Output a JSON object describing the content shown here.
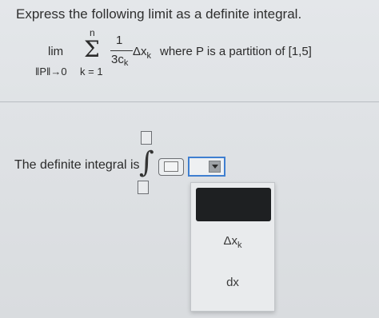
{
  "question": {
    "prompt": "Express the following limit as a definite integral."
  },
  "limit_expression": {
    "lim": "lim",
    "lim_sub": "‖P‖→0",
    "sum_upper": "n",
    "sum_symbol": "Σ",
    "sum_lower": "k = 1",
    "frac_numerator": "1",
    "frac_denominator": "3c",
    "frac_denominator_sub": "k",
    "delta": "Δx",
    "delta_sub": "k",
    "where_text": "where P is a partition of [1,5]"
  },
  "answer": {
    "label": "The definite integral is",
    "integral_symbol": "∫"
  },
  "dropdown": {
    "options": [
      {
        "main": "",
        "sub": ""
      },
      {
        "main": "Δx",
        "sub": "k"
      },
      {
        "main": "dx",
        "sub": ""
      }
    ]
  },
  "colors": {
    "accent_blue": "#3f7fd0",
    "selected_option_bg": "#1e2022",
    "background": "#dfe2e5"
  }
}
